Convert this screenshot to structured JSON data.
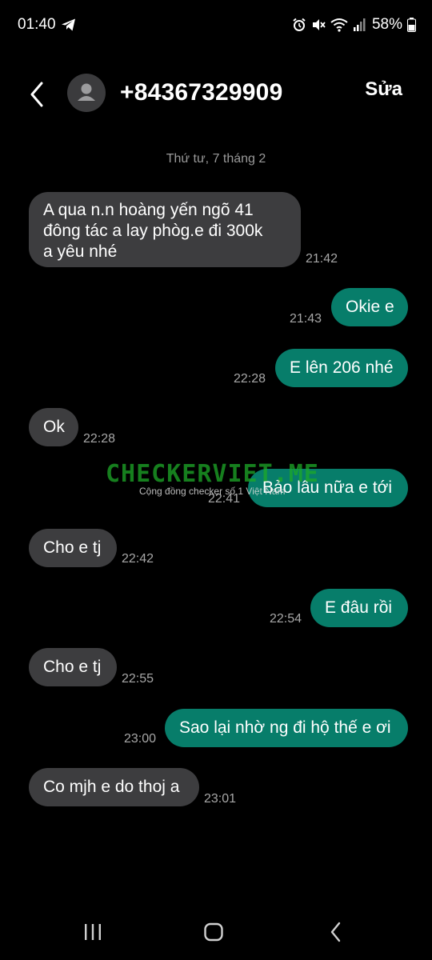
{
  "status_bar": {
    "time": "01:40",
    "battery": "58%",
    "icons": [
      "telegram-icon",
      "alarm-icon",
      "mute-icon",
      "wifi-icon",
      "signal-icon",
      "battery-icon"
    ]
  },
  "header": {
    "title": "+84367329909",
    "edit_label": "Sửa",
    "icons": [
      "back-chevron-icon",
      "person-icon"
    ]
  },
  "conversation": {
    "date": "Thứ tư, 7 tháng 2",
    "messages": [
      {
        "direction": "incoming",
        "lines": [
          "A qua n.n hoàng yến ngõ 41",
          "đông tác a lay phòg.e đi 300k",
          "a yêu nhé"
        ],
        "time": "21:42"
      },
      {
        "direction": "outgoing",
        "text": "Okie e",
        "time": "21:43"
      },
      {
        "direction": "outgoing",
        "text": "E lên 206 nhé",
        "time": "22:28"
      },
      {
        "direction": "incoming",
        "text": "Ok",
        "time": "22:28"
      },
      {
        "direction": "outgoing",
        "text": "Bảo lâu nữa e tới",
        "time": "22:41"
      },
      {
        "direction": "incoming",
        "text": "Cho e tj",
        "time": "22:42"
      },
      {
        "direction": "outgoing",
        "text": "E đâu rồi",
        "time": "22:54"
      },
      {
        "direction": "incoming",
        "text": "Cho e tj",
        "time": "22:55"
      },
      {
        "direction": "outgoing",
        "text": "Sao lại nhờ ng đi hộ thế e ơi",
        "time": "23:00"
      },
      {
        "direction": "incoming",
        "text": "Co mjh e do thoj a",
        "time": "23:01"
      }
    ]
  },
  "watermark": {
    "title": "CHECKERVIET.ME",
    "subtitle": "Cộng đồng checker số 1 Việt Nam"
  },
  "colors": {
    "background": "#000000",
    "incoming_bubble": "#3d3d3f",
    "outgoing_bubble": "#077d6a",
    "timestamp": "#a7a7a7"
  },
  "nav_bar": {
    "icons": [
      "recent-apps-icon",
      "home-icon",
      "back-icon"
    ]
  }
}
